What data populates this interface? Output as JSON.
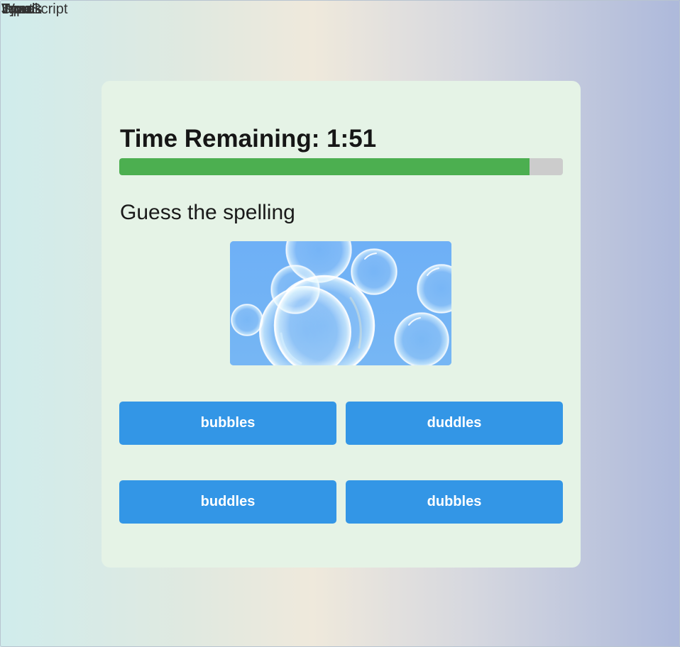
{
  "window": {
    "overlapping_labels": [
      "Input",
      "Words",
      "Speak",
      "JavaScript",
      "Type"
    ]
  },
  "game": {
    "timer_label": "Time Remaining: 1:51",
    "progress": 0.925,
    "prompt": "Guess the spelling",
    "image_subject": "bubbles",
    "choices": [
      "bubbles",
      "duddles",
      "buddles",
      "dubbles"
    ]
  },
  "colors": {
    "progress_fill": "#4caf50",
    "progress_track": "#cccccc",
    "button": "#3396e6",
    "card": "#e5f3e6"
  }
}
